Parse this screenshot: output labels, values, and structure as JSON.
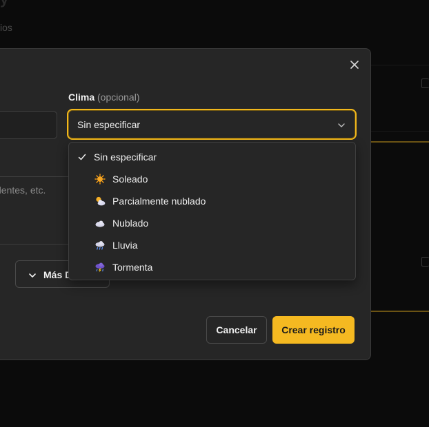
{
  "background": {
    "subtitle_fragment": "ios"
  },
  "modal": {
    "left_fragment_text": "dentes, etc.",
    "clima": {
      "label": "Clima",
      "optional": "(opcional)",
      "selected": "Sin especificar",
      "options": [
        {
          "label": "Sin especificar",
          "icon": "check-icon",
          "selected": true
        },
        {
          "label": "Soleado",
          "icon": "sun-icon"
        },
        {
          "label": "Parcialmente nublado",
          "icon": "sun-behind-cloud-icon"
        },
        {
          "label": "Nublado",
          "icon": "cloud-icon"
        },
        {
          "label": "Lluvia",
          "icon": "rain-cloud-icon"
        },
        {
          "label": "Tormenta",
          "icon": "storm-cloud-icon"
        }
      ]
    },
    "more_button_label": "Más D",
    "cancel_label": "Cancelar",
    "create_label": "Crear registro"
  },
  "colors": {
    "accent": "#f5b921",
    "modal_bg": "#262626",
    "page_bg": "#0b0b0b"
  }
}
